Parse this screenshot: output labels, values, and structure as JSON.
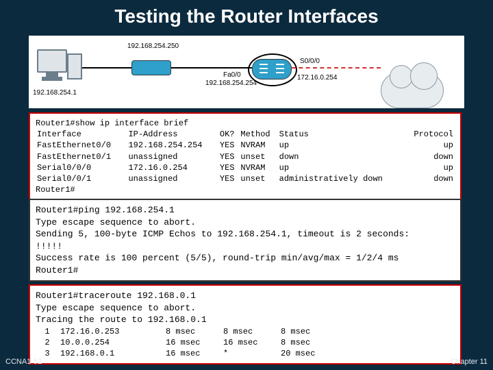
{
  "title": "Testing the Router Interfaces",
  "footer": {
    "left": "CCNA1-52",
    "right": "Chapter 11"
  },
  "diagram": {
    "pc_ip": "192.168.254.1",
    "switch_ip": "192.168.254.250",
    "router_lan_if": "Fa0/0",
    "router_lan_ip": "192.168.254.254",
    "router_wan_if": "S0/0/0",
    "router_wan_ip": "172.16.0.254"
  },
  "show_ip": {
    "cmd": "Router1#show ip interface brief",
    "cols": [
      "Interface",
      "IP-Address",
      "OK?",
      "Method",
      "Status",
      "Protocol"
    ],
    "rows": [
      {
        "if": "FastEthernet0/0",
        "ip": "192.168.254.254",
        "ok": "YES",
        "method": "NVRAM",
        "status": "up",
        "proto": "up"
      },
      {
        "if": "FastEthernet0/1",
        "ip": "unassigned",
        "ok": "YES",
        "method": "unset",
        "status": "down",
        "proto": "down"
      },
      {
        "if": "Serial0/0/0",
        "ip": "172.16.0.254",
        "ok": "YES",
        "method": "NVRAM",
        "status": "up",
        "proto": "up"
      },
      {
        "if": "Serial0/0/1",
        "ip": "unassigned",
        "ok": "YES",
        "method": "unset",
        "status": "administratively down",
        "proto": "down"
      }
    ],
    "prompt": "Router1#"
  },
  "ping": {
    "lines": [
      "Router1#ping 192.168.254.1",
      "Type escape sequence to abort.",
      "Sending 5, 100-byte ICMP Echos to 192.168.254.1, timeout is 2 seconds:",
      "!!!!!",
      "Success rate is 100 percent (5/5), round-trip min/avg/max = 1/2/4 ms",
      "Router1#"
    ]
  },
  "trace": {
    "cmd": "Router1#traceroute 192.168.0.1",
    "l2": "Type escape sequence to abort.",
    "l3": "Tracing the route to 192.168.0.1",
    "hops": [
      {
        "n": "1",
        "ip": "172.16.0.253",
        "a": "8 msec",
        "b": "8 msec",
        "c": "8 msec"
      },
      {
        "n": "2",
        "ip": "10.0.0.254",
        "a": "16 msec",
        "b": "16 msec",
        "c": "8 msec"
      },
      {
        "n": "3",
        "ip": "192.168.0.1",
        "a": "16 msec",
        "b": "*",
        "c": "20 msec"
      }
    ]
  }
}
